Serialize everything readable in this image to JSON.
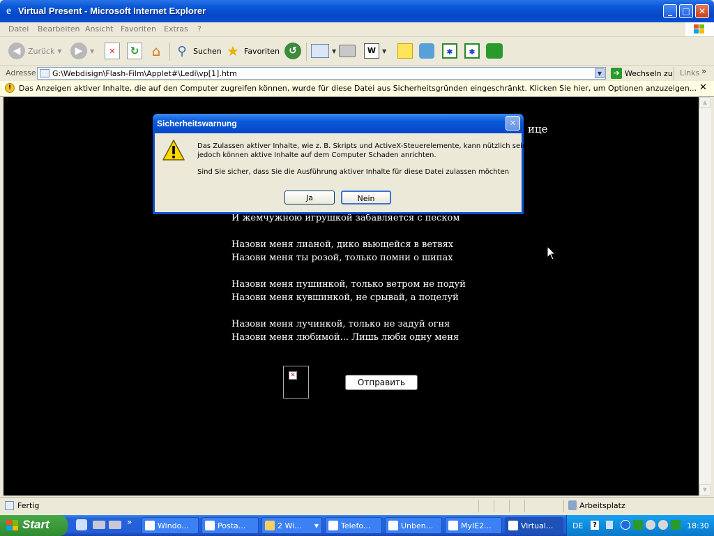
{
  "window": {
    "title": "Virtual Present - Microsoft Internet Explorer",
    "minimize": "_",
    "maximize": "□",
    "close": "✕"
  },
  "menu": [
    "Datei",
    "Bearbeiten",
    "Ansicht",
    "Favoriten",
    "Extras",
    "?"
  ],
  "toolbar": {
    "back_label": "Zurück",
    "search_label": "Suchen",
    "favorites_label": "Favoriten"
  },
  "address": {
    "label": "Adresse",
    "url": "G:\\Webdisign\\Flash-Film\\Applet#\\Ledi\\vp[1].htm",
    "go_label": "Wechseln zu",
    "links_label": "Links"
  },
  "infobar": {
    "text": "Das Anzeigen aktiver Inhalte, die auf den Computer zugreifen können, wurde für diese Datei aus Sicherheitsgründen eingeschränkt. Klicken Sie hier, um Optionen anzuzeigen...",
    "close": "✕"
  },
  "page": {
    "partial_heading": "ице",
    "poem": [
      "И жемчужною игрушкой забавляется с песком",
      "Назови меня лианой, дико вьющейся в ветвях",
      "Назови меня ты розой, только помни о шипах",
      "Назови меня пушинкой, только ветром не подуй",
      "Назови меня кувшинкой, не срывай, а поцелуй",
      "Назови меня лучинкой, только не задуй огня",
      "Назови меня любимой... Лишь люби одну меня"
    ],
    "submit_label": "Отправить"
  },
  "dialog": {
    "title": "Sicherheitswarnung",
    "message_line1": "Das Zulassen aktiver Inhalte, wie z. B. Skripts und ActiveX-Steuerelemente, kann nützlich sein,",
    "message_line2": "jedoch können aktive Inhalte auf dem Computer Schaden anrichten.",
    "question": "Sind Sie sicher, dass Sie die Ausführung aktiver Inhalte für diese Datei zulassen möchten",
    "yes_label": "Ja",
    "no_label": "Nein",
    "close": "✕"
  },
  "status": {
    "text": "Fertig",
    "zone": "Arbeitsplatz"
  },
  "taskbar": {
    "start_label": "Start",
    "tasks": [
      "Windo...",
      "Posta...",
      "2 Wi...",
      "Telefo...",
      "Unben...",
      "MyIE2...",
      "Virtual..."
    ],
    "language": "DE",
    "clock": "18:30"
  },
  "colors": {
    "titlebar": "#0a58d8",
    "content_bg": "#000000",
    "infobar_bg": "#ffffe1",
    "taskbar": "#245edb",
    "start_green": "#3c9a3c"
  }
}
